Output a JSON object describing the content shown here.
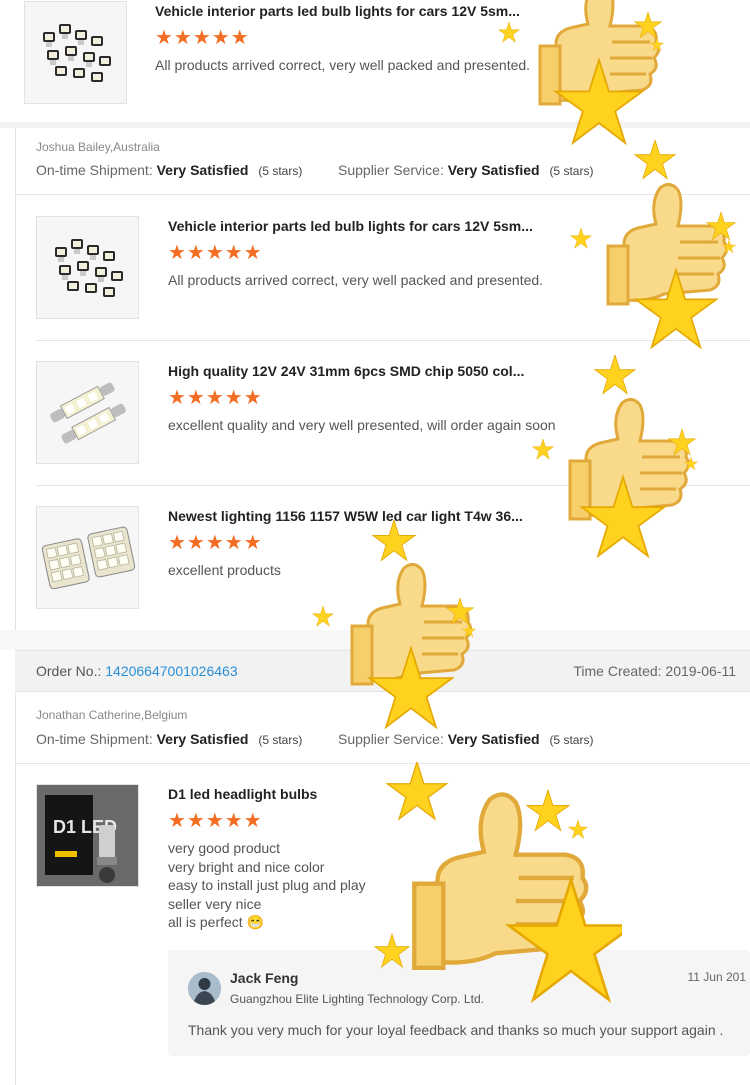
{
  "products": {
    "interior_bulbs_title": "Vehicle interior parts led bulb lights for cars 12V 5sm...",
    "festoon_title": "High quality 12V 24V 31mm 6pcs SMD chip 5050 col...",
    "w5w_title": "Newest lighting 1156 1157 W5W led car light T4w 36...",
    "headlight_title": "D1 led headlight bulbs"
  },
  "stars": "★★★★★",
  "review_texts": {
    "interior": "All products arrived correct, very well packed and presented.",
    "festoon": "excellent quality and very well presented, will order again soon",
    "w5w": "excellent products",
    "headlight_lines": [
      "very good product",
      "very bright and nice color",
      "easy to install just plug and play",
      "seller very nice",
      "all is perfect 😁"
    ]
  },
  "reviews": [
    {
      "reviewer": "Joshua Bailey,Australia",
      "shipment_label": "On-time Shipment:",
      "shipment_value": "Very Satisfied",
      "shipment_stars": "(5 stars)",
      "service_label": "Supplier Service:",
      "service_value": "Very Satisfied",
      "service_stars": "(5 stars)"
    },
    {
      "order_label": "Order No.:",
      "order_number": "14206647001026463",
      "time_created": "Time Created: 2019-06-11",
      "reviewer": "Jonathan Catherine,Belgium",
      "shipment_label": "On-time Shipment:",
      "shipment_value": "Very Satisfied",
      "shipment_stars": "(5 stars)",
      "service_label": "Supplier Service:",
      "service_value": "Very Satisfied",
      "service_stars": "(5 stars)"
    }
  ],
  "reply": {
    "name": "Jack Feng",
    "company": "Guangzhou Elite Lighting Technology Corp. Ltd.",
    "date": "11 Jun 201",
    "text": "Thank you very much for your loyal feedback and thanks so much your support again ."
  },
  "image_text": {
    "headlight_box_logo": "D1 LED"
  },
  "colors": {
    "star_orange": "#f36d22",
    "link_blue": "#2a8fd6",
    "deco_star_yellow": "#ffd21f",
    "deco_thumb": "#f9d98a"
  },
  "icons": {
    "rating": "star-icon",
    "decoration": "thumbs-up-with-stars"
  }
}
